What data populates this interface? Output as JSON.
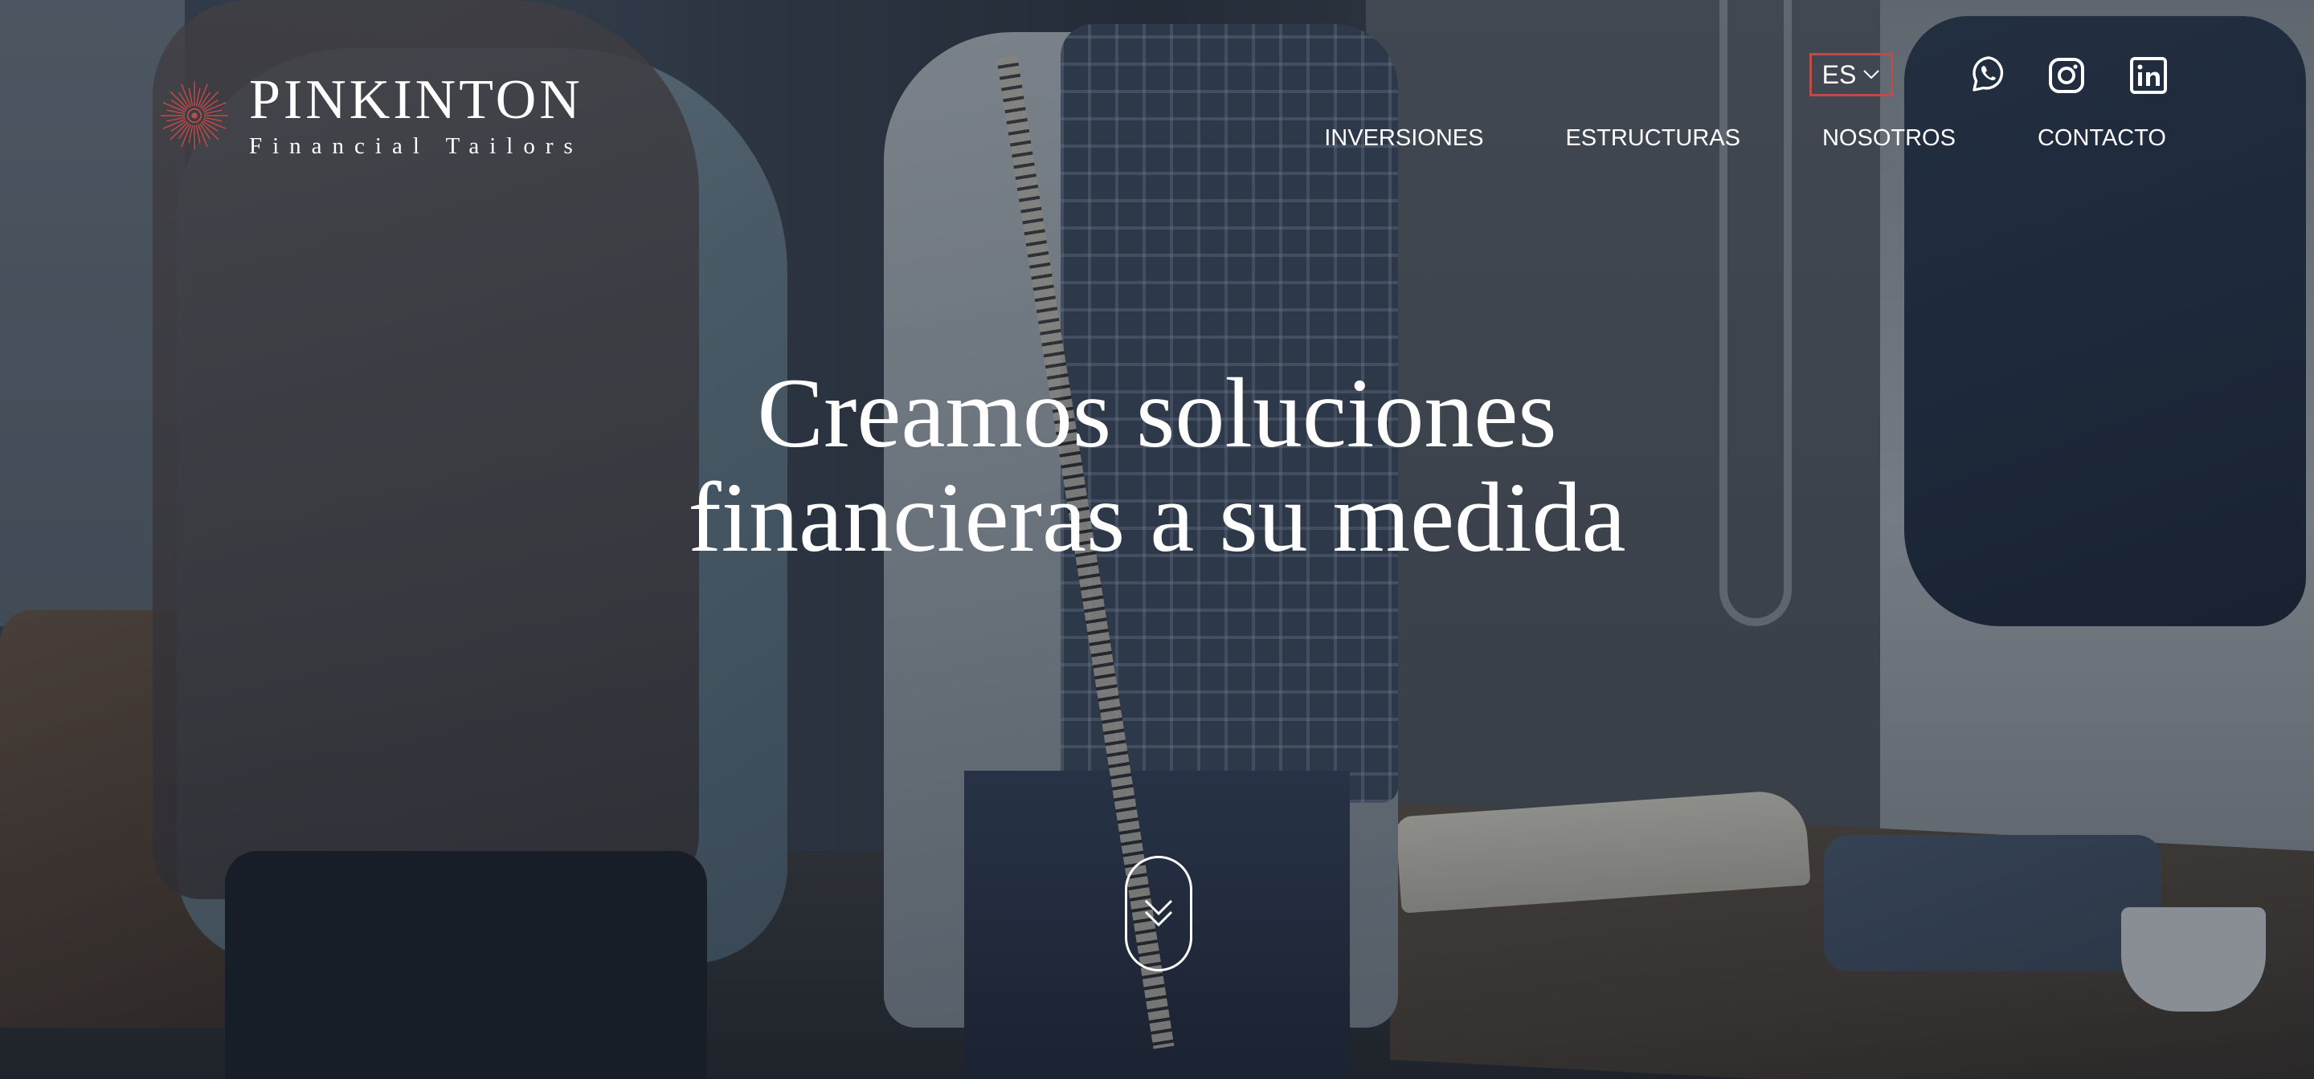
{
  "brand": {
    "name": "PINKINTON",
    "tagline": "Financial Tailors",
    "accent_color": "#c04a48"
  },
  "header": {
    "language": {
      "selected": "ES",
      "icon": "chevron-down-icon"
    },
    "social": [
      {
        "name": "whatsapp",
        "icon": "whatsapp-icon"
      },
      {
        "name": "instagram",
        "icon": "instagram-icon"
      },
      {
        "name": "linkedin",
        "icon": "linkedin-icon"
      }
    ],
    "nav": [
      {
        "label": "INVERSIONES"
      },
      {
        "label": "ESTRUCTURAS"
      },
      {
        "label": "NOSOTROS"
      },
      {
        "label": "CONTACTO"
      }
    ]
  },
  "hero": {
    "title_line1": "Creamos soluciones",
    "title_line2": "financieras a su medida",
    "scroll_icon": "double-chevron-down-icon"
  }
}
